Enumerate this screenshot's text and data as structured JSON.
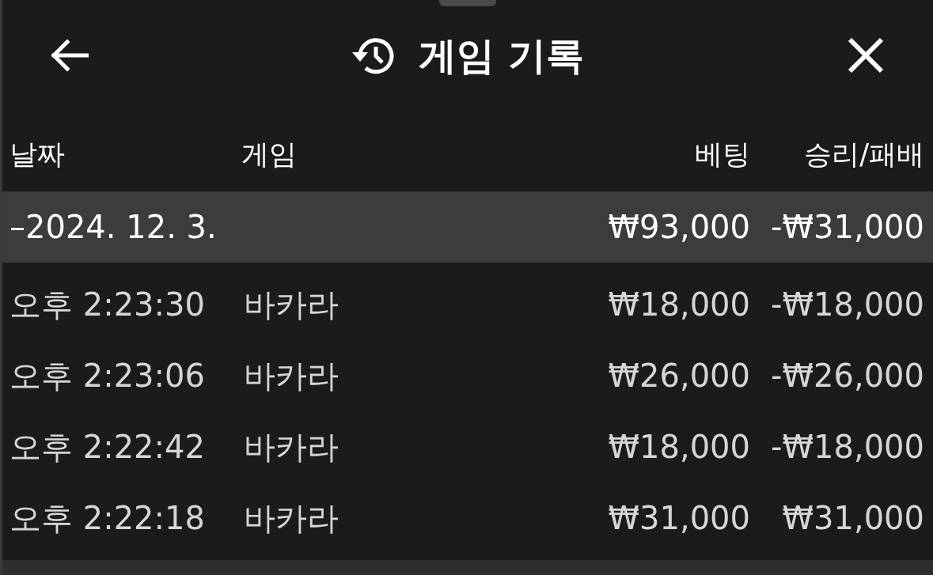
{
  "header": {
    "title": "게임 기록"
  },
  "table": {
    "columns": [
      "날짜",
      "게임",
      "베팅",
      "승리/패배"
    ],
    "groups": [
      {
        "date": "–2024. 12. 3.",
        "bet": "₩93,000",
        "result": "-₩31,000",
        "rows": [
          {
            "time": "오후 2:23:30",
            "game": "바카라",
            "bet": "₩18,000",
            "result": "-₩18,000"
          },
          {
            "time": "오후 2:23:06",
            "game": "바카라",
            "bet": "₩26,000",
            "result": "-₩26,000"
          },
          {
            "time": "오후 2:22:42",
            "game": "바카라",
            "bet": "₩18,000",
            "result": "-₩18,000"
          },
          {
            "time": "오후 2:22:18",
            "game": "바카라",
            "bet": "₩31,000",
            "result": "₩31,000"
          }
        ]
      }
    ]
  }
}
